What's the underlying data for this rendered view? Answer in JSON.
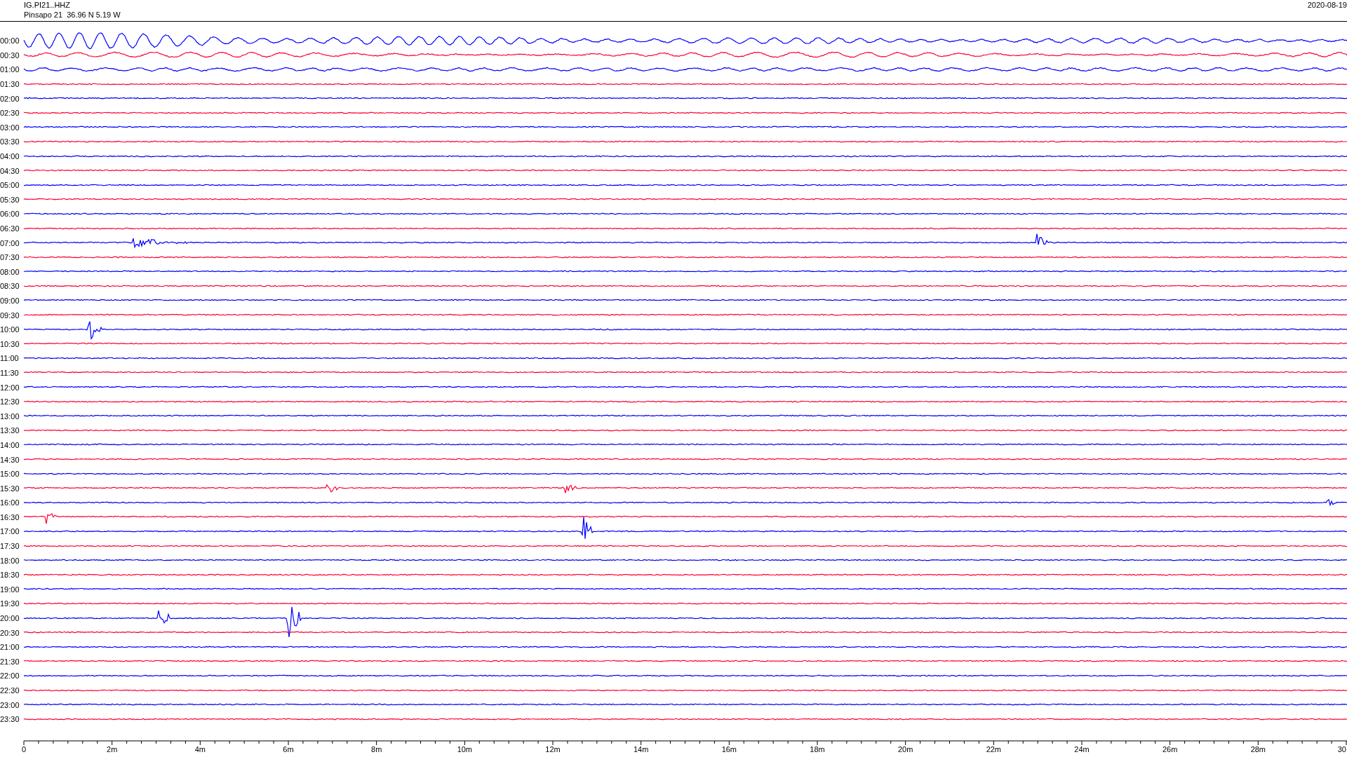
{
  "header": {
    "station": "IG.PI21..HHZ",
    "location": "Pinsapo 21  36.96 N 5.19 W",
    "date": "2020-08-19"
  },
  "rows": [
    {
      "time": "00:00",
      "color": "#0000ff"
    },
    {
      "time": "00:30",
      "color": "#ff0033"
    },
    {
      "time": "01:00",
      "color": "#0000ff"
    },
    {
      "time": "01:30",
      "color": "#ff0033"
    },
    {
      "time": "02:00",
      "color": "#0000ff"
    },
    {
      "time": "02:30",
      "color": "#ff0033"
    },
    {
      "time": "03:00",
      "color": "#0000ff"
    },
    {
      "time": "03:30",
      "color": "#ff0033"
    },
    {
      "time": "04:00",
      "color": "#0000ff"
    },
    {
      "time": "04:30",
      "color": "#ff0033"
    },
    {
      "time": "05:00",
      "color": "#0000ff"
    },
    {
      "time": "05:30",
      "color": "#ff0033"
    },
    {
      "time": "06:00",
      "color": "#0000ff"
    },
    {
      "time": "06:30",
      "color": "#ff0033"
    },
    {
      "time": "07:00",
      "color": "#0000ff"
    },
    {
      "time": "07:30",
      "color": "#ff0033"
    },
    {
      "time": "08:00",
      "color": "#0000ff"
    },
    {
      "time": "08:30",
      "color": "#ff0033"
    },
    {
      "time": "09:00",
      "color": "#0000ff"
    },
    {
      "time": "09:30",
      "color": "#ff0033"
    },
    {
      "time": "10:00",
      "color": "#0000ff"
    },
    {
      "time": "10:30",
      "color": "#ff0033"
    },
    {
      "time": "11:00",
      "color": "#0000ff"
    },
    {
      "time": "11:30",
      "color": "#ff0033"
    },
    {
      "time": "12:00",
      "color": "#0000ff"
    },
    {
      "time": "12:30",
      "color": "#ff0033"
    },
    {
      "time": "13:00",
      "color": "#0000ff"
    },
    {
      "time": "13:30",
      "color": "#ff0033"
    },
    {
      "time": "14:00",
      "color": "#0000ff"
    },
    {
      "time": "14:30",
      "color": "#ff0033"
    },
    {
      "time": "15:00",
      "color": "#0000ff"
    },
    {
      "time": "15:30",
      "color": "#ff0033"
    },
    {
      "time": "16:00",
      "color": "#0000ff"
    },
    {
      "time": "16:30",
      "color": "#ff0033"
    },
    {
      "time": "17:00",
      "color": "#0000ff"
    },
    {
      "time": "17:30",
      "color": "#ff0033"
    },
    {
      "time": "18:00",
      "color": "#0000ff"
    },
    {
      "time": "18:30",
      "color": "#ff0033"
    },
    {
      "time": "19:00",
      "color": "#0000ff"
    },
    {
      "time": "19:30",
      "color": "#ff0033"
    },
    {
      "time": "20:00",
      "color": "#0000ff"
    },
    {
      "time": "20:30",
      "color": "#ff0033"
    },
    {
      "time": "21:00",
      "color": "#0000ff"
    },
    {
      "time": "21:30",
      "color": "#ff0033"
    },
    {
      "time": "22:00",
      "color": "#0000ff"
    },
    {
      "time": "22:30",
      "color": "#ff0033"
    },
    {
      "time": "23:00",
      "color": "#0000ff"
    },
    {
      "time": "23:30",
      "color": "#ff0033"
    }
  ],
  "axis": {
    "labels": [
      "0",
      "2m",
      "4m",
      "6m",
      "8m",
      "10m",
      "12m",
      "14m",
      "16m",
      "18m",
      "20m",
      "22m",
      "24m",
      "26m",
      "28m",
      "30"
    ]
  }
}
